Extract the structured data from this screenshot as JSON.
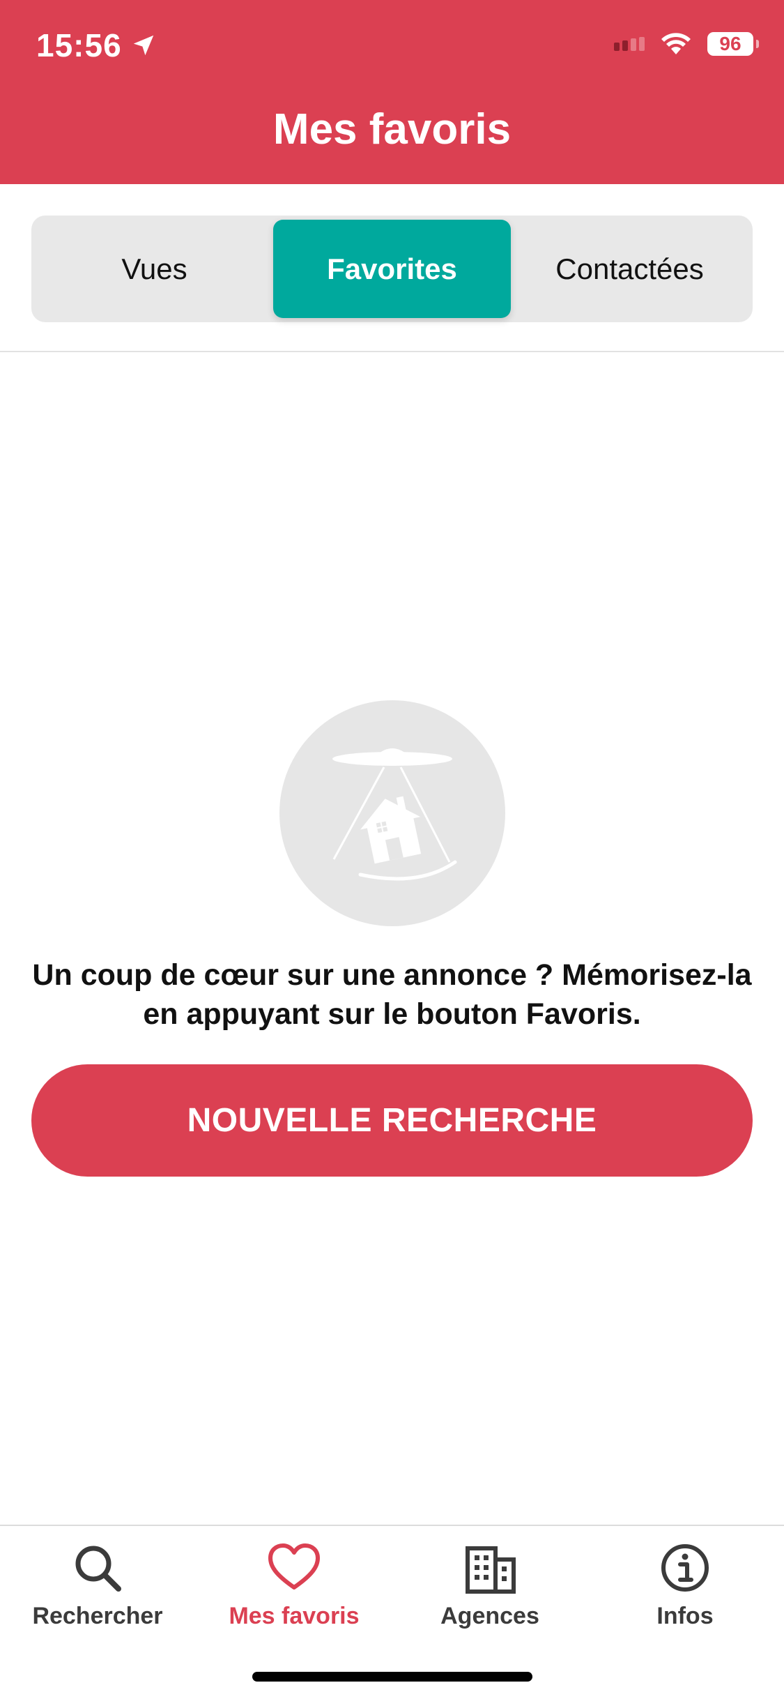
{
  "status_bar": {
    "time": "15:56",
    "battery": "96",
    "icons": [
      "location-arrow-icon",
      "cellular-signal-icon",
      "wifi-icon",
      "battery-icon"
    ]
  },
  "header": {
    "title": "Mes favoris",
    "background_color": "#db4052"
  },
  "segmented_control": {
    "tabs": [
      {
        "label": "Vues",
        "selected": false
      },
      {
        "label": "Favorites",
        "selected": true
      },
      {
        "label": "Contactées",
        "selected": false
      }
    ],
    "active_color": "#00a99d"
  },
  "empty_state": {
    "illustration": "ufo-abducting-house-icon",
    "message": "Un coup de cœur sur une annonce ? Mémorisez-la en appuyant sur le bouton Favoris.",
    "button_label": "NOUVELLE RECHERCHE"
  },
  "tab_bar": {
    "items": [
      {
        "label": "Rechercher",
        "icon": "search-icon",
        "active": false
      },
      {
        "label": "Mes favoris",
        "icon": "heart-icon",
        "active": true
      },
      {
        "label": "Agences",
        "icon": "building-icon",
        "active": false
      },
      {
        "label": "Infos",
        "icon": "info-icon",
        "active": false
      }
    ],
    "active_color": "#db4052"
  }
}
